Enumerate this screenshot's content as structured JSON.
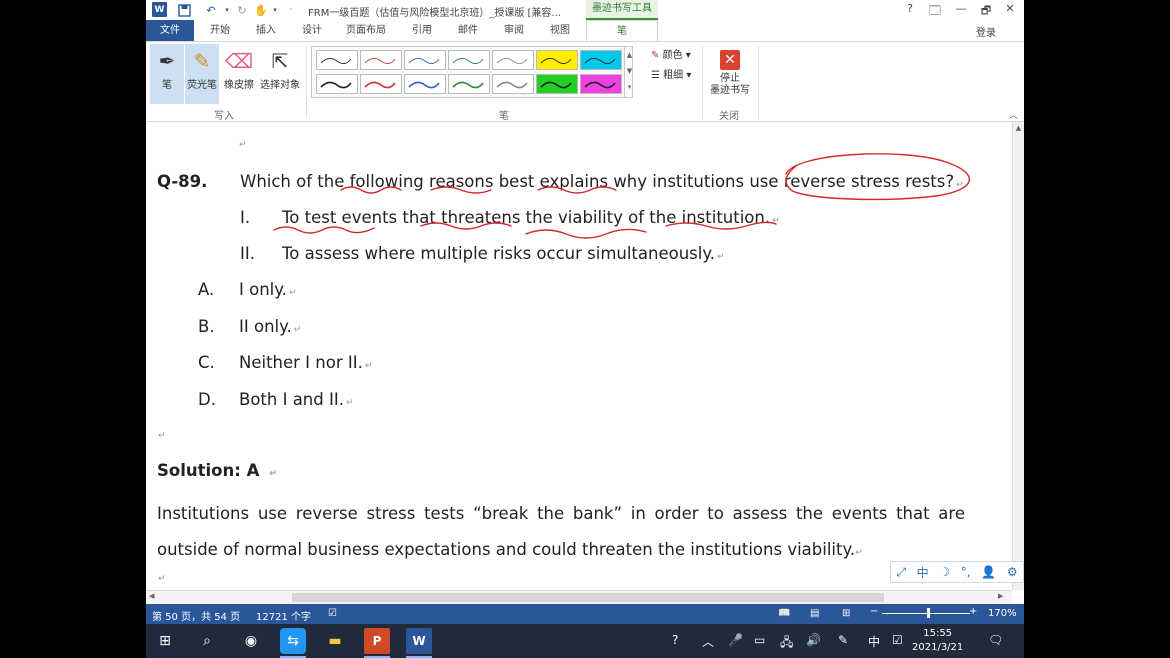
{
  "titlebar": {
    "app_logo": "W",
    "doc_title": "FRM一级百题（估值与风险模型北京班）_授课版 [兼容...",
    "context_tab": "墨迹书写工具",
    "help": "?",
    "min": "—",
    "max": "🗗",
    "close": "✕"
  },
  "tabs": {
    "file": "文件",
    "items": [
      "开始",
      "插入",
      "设计",
      "页面布局",
      "引用",
      "邮件",
      "审阅",
      "视图"
    ],
    "active": "笔",
    "login": "登录"
  },
  "ribbon": {
    "pen": "笔",
    "highlighter": "荧光笔",
    "eraser": "橡皮擦",
    "select": "选择对象",
    "group_write": "写入",
    "group_pens": "笔",
    "color": "颜色",
    "thickness": "粗细",
    "stop_ink_line1": "停止",
    "stop_ink_line2": "墨迹书写",
    "group_close": "关闭",
    "pen_colors": [
      "#222222",
      "#d03030",
      "#3060c0",
      "#2a8a3a",
      "#888888",
      "#ffee00",
      "#00c8e8",
      "#222222",
      "#d03030",
      "#3060c0",
      "#2a8a3a",
      "#888888",
      "#22d022",
      "#f040e0"
    ]
  },
  "document": {
    "question_number": "Q-89.",
    "question_text": "Which of the following reasons best explains why institutions use reverse stress rests?",
    "statements": [
      {
        "numeral": "I.",
        "text": "To test events that threatens the viability of the institution."
      },
      {
        "numeral": "II.",
        "text": "To assess where multiple risks occur simultaneously."
      }
    ],
    "options": [
      {
        "letter": "A.",
        "text": "I only."
      },
      {
        "letter": "B.",
        "text": "II only."
      },
      {
        "letter": "C.",
        "text": "Neither I nor II."
      },
      {
        "letter": "D.",
        "text": "Both I and II."
      }
    ],
    "solution_label": "Solution: A",
    "solution_text": "Institutions use reverse stress tests “break the bank” in order to assess the events that are outside of normal business expectations and could threaten the institutions viability.",
    "paragraph_mark": "↵",
    "ink_color": "#d42a2a"
  },
  "ime_bar": [
    "⤢",
    "中",
    "☽",
    "°,",
    "👤",
    "⚙"
  ],
  "statusbar": {
    "page": "第 50 页，共 54 页",
    "words": "12721 个字",
    "zoom": "170%"
  },
  "taskbar": {
    "clock_time": "15:55",
    "clock_date": "2021/3/21",
    "ime_lang": "中"
  }
}
